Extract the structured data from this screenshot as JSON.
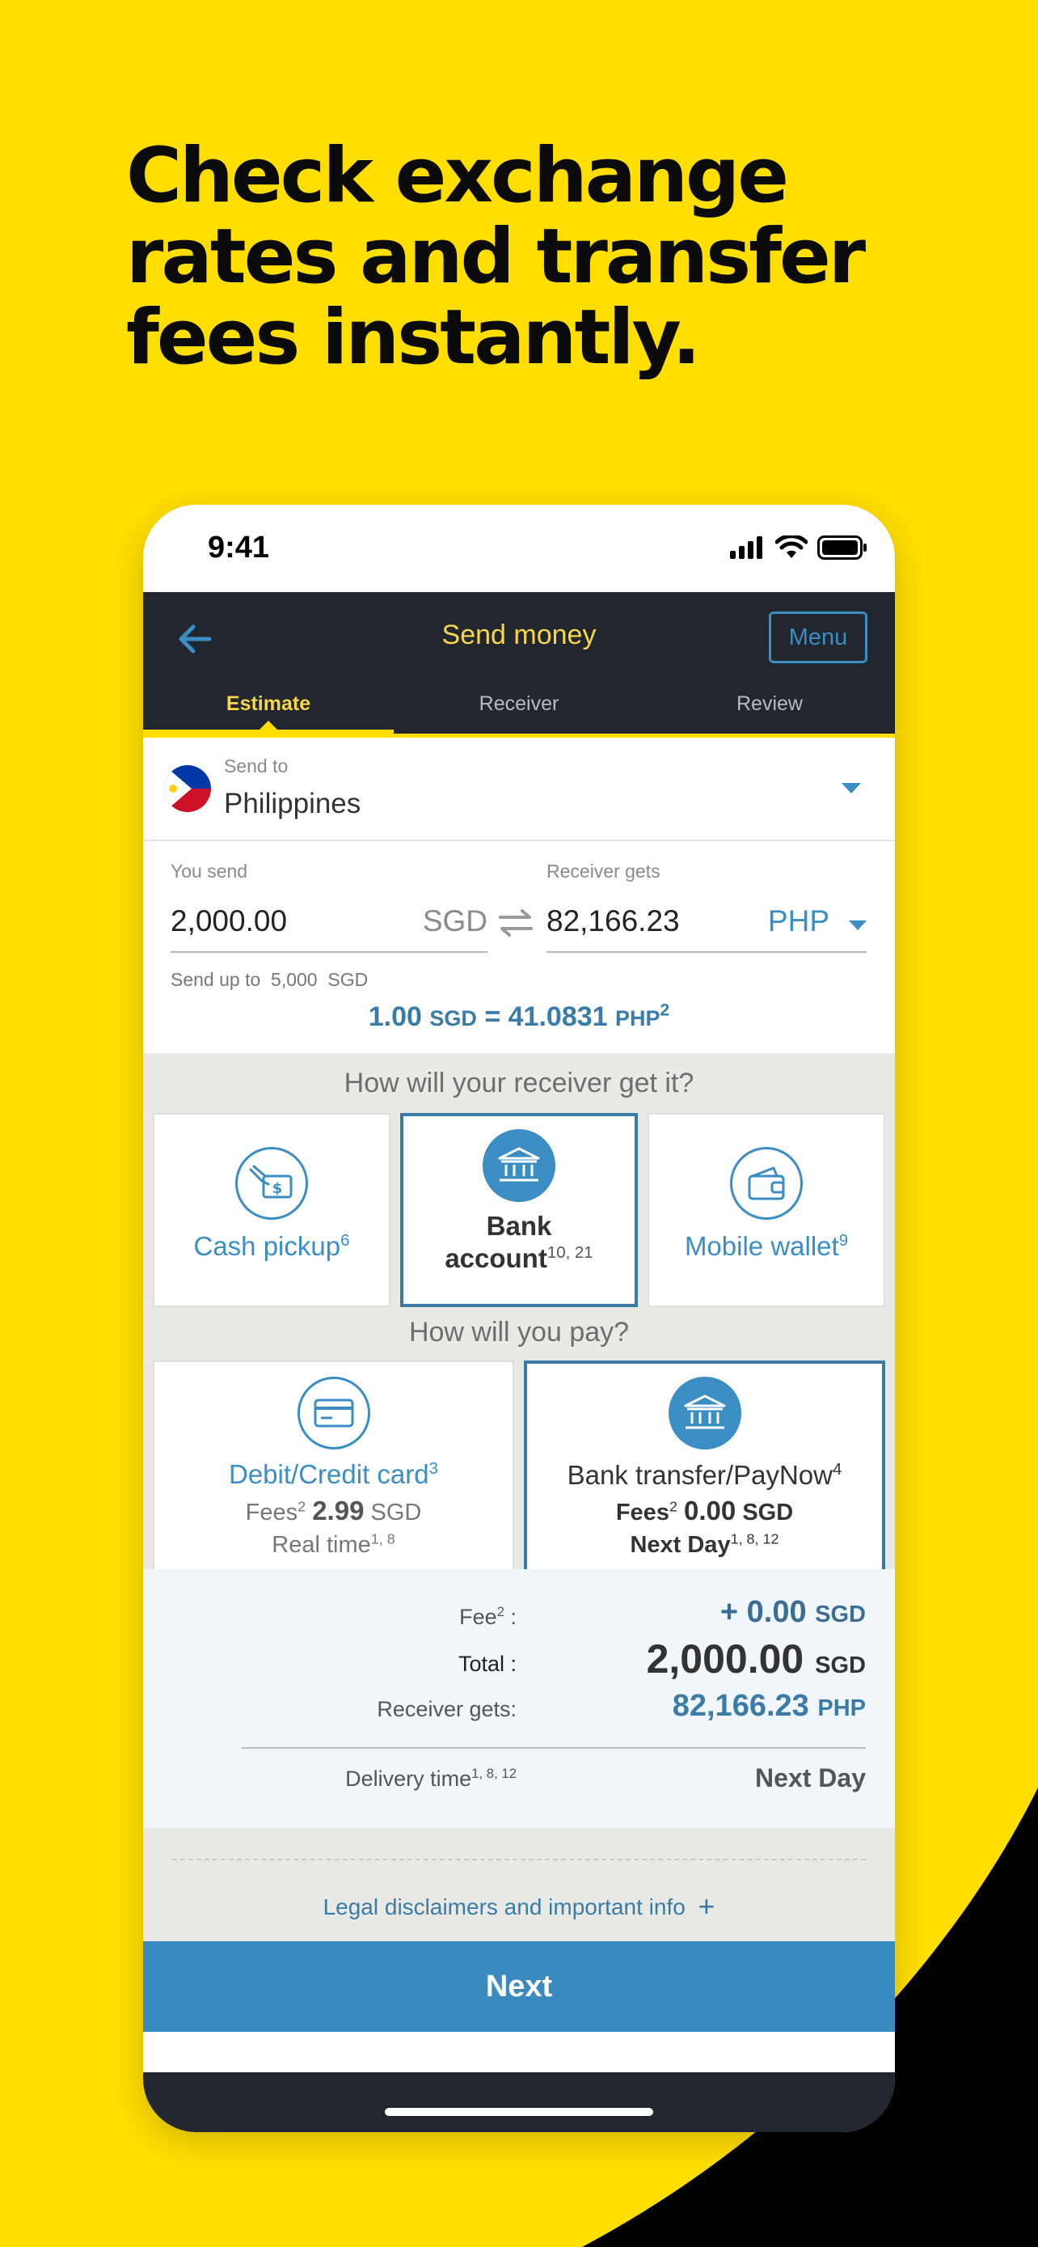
{
  "headline": {
    "line1": "Check exchange",
    "line2": "rates and transfer",
    "line3": "fees instantly."
  },
  "status_bar": {
    "time": "9:41"
  },
  "app_bar": {
    "title": "Send money",
    "menu_label": "Menu"
  },
  "tabs": [
    {
      "label": "Estimate",
      "active": true
    },
    {
      "label": "Receiver",
      "active": false
    },
    {
      "label": "Review",
      "active": false
    }
  ],
  "send_to": {
    "label": "Send to",
    "value": "Philippines"
  },
  "you_send": {
    "label": "You send",
    "amount": "2,000.00",
    "currency": "SGD"
  },
  "receiver_gets": {
    "label": "Receiver gets",
    "amount": "82,166.23",
    "currency": "PHP"
  },
  "send_limit": {
    "prefix": "Send up to",
    "amount": "5,000",
    "currency": "SGD"
  },
  "rate": {
    "left_value": "1.00",
    "left_currency": "SGD",
    "equals": "=",
    "right_value": "41.0831",
    "right_currency": "PHP",
    "note": "2"
  },
  "receive_question": "How will your receiver get it?",
  "receive_options": [
    {
      "label": "Cash pickup",
      "note": "6",
      "selected": false
    },
    {
      "label_line1": "Bank",
      "label_line2": "account",
      "note": "10, 21",
      "selected": true
    },
    {
      "label": "Mobile wallet",
      "note": "9",
      "selected": false
    }
  ],
  "pay_question": "How will you pay?",
  "pay_options": [
    {
      "label": "Debit/Credit card",
      "note": "3",
      "fees_label": "Fees",
      "fees_note": "2",
      "fees_value": "2.99",
      "fees_currency": "SGD",
      "speed": "Real time",
      "speed_note": "1, 8",
      "selected": false
    },
    {
      "label": "Bank transfer/PayNow",
      "note": "4",
      "fees_label": "Fees",
      "fees_note": "2",
      "fees_value": "0.00",
      "fees_currency": "SGD",
      "speed": "Next Day",
      "speed_note": "1, 8, 12",
      "selected": true
    }
  ],
  "summary": {
    "fee_label": "Fee",
    "fee_note": "2",
    "fee_value": "+ 0.00",
    "fee_currency": "SGD",
    "total_label": "Total :",
    "total_value": "2,000.00",
    "total_currency": "SGD",
    "receiver_label": "Receiver gets:",
    "receiver_value": "82,166.23",
    "receiver_currency": "PHP",
    "delivery_label": "Delivery time",
    "delivery_note": "1, 8, 12",
    "delivery_value": "Next Day"
  },
  "legal_link": "Legal disclaimers and important info",
  "next_label": "Next",
  "colors": {
    "background": "#FFDE00",
    "accent_blue": "#3A8EC4",
    "app_bar": "#22262E",
    "tab_active": "#F7D64A"
  }
}
